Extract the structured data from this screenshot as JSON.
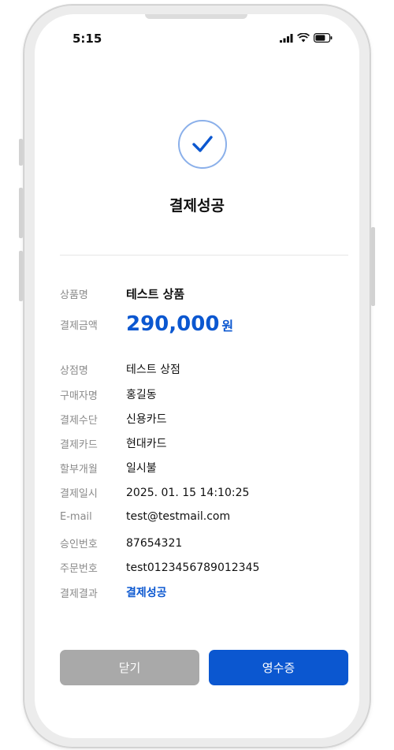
{
  "status_bar": {
    "time": "5:15"
  },
  "result": {
    "title": "결제성공"
  },
  "product": {
    "label": "상품명",
    "value": "테스트 상품"
  },
  "amount": {
    "label": "결제금액",
    "value": "290,000",
    "unit": "원"
  },
  "details": [
    {
      "label": "상점명",
      "value": "테스트 상점"
    },
    {
      "label": "구매자명",
      "value": "홍길동"
    },
    {
      "label": "결제수단",
      "value": "신용카드"
    },
    {
      "label": "결제카드",
      "value": "현대카드"
    },
    {
      "label": "할부개월",
      "value": "일시불"
    },
    {
      "label": "결제일시",
      "value": "2025. 01. 15 14:10:25"
    },
    {
      "label": "E-mail",
      "value": "test@testmail.com"
    },
    {
      "label": "승인번호",
      "value": "87654321"
    },
    {
      "label": "주문번호",
      "value": "test0123456789012345"
    },
    {
      "label": "결제결과",
      "value": "결제성공"
    }
  ],
  "buttons": {
    "close": "닫기",
    "receipt": "영수증"
  },
  "colors": {
    "accent": "#0b57d0",
    "disabled": "#a9a9a9"
  }
}
